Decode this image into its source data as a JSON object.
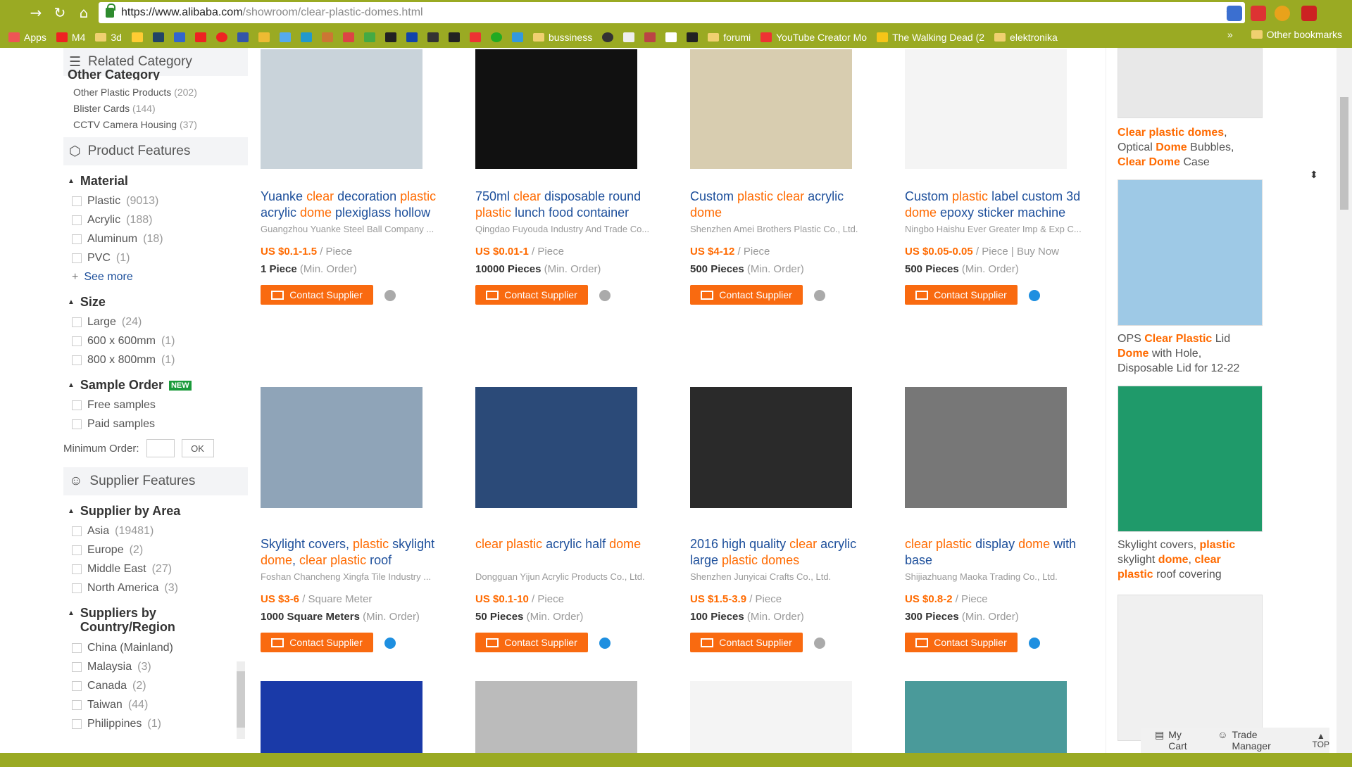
{
  "browser": {
    "url_host": "https://www.alibaba.com",
    "url_path": "/showroom/clear-plastic-domes.html",
    "bookmarks": [
      "Apps",
      "M4",
      "3d",
      "bussiness",
      "forumi",
      "YouTube Creator Mo",
      "The Walking Dead (2",
      "elektronika"
    ],
    "other_bookmarks": "Other bookmarks",
    "chevron": "»"
  },
  "sidebar": {
    "related_category": "Related Category",
    "other_category": "Other Category",
    "other_items": [
      {
        "label": "Other Plastic Products",
        "count": "(202)"
      },
      {
        "label": "Blister Cards",
        "count": "(144)"
      },
      {
        "label": "CCTV Camera Housing",
        "count": "(37)"
      }
    ],
    "product_features": "Product Features",
    "material": "Material",
    "material_items": [
      {
        "label": "Plastic",
        "count": "(9013)"
      },
      {
        "label": "Acrylic",
        "count": "(188)"
      },
      {
        "label": "Aluminum",
        "count": "(18)"
      },
      {
        "label": "PVC",
        "count": "(1)"
      }
    ],
    "see_more": "See more",
    "size": "Size",
    "size_items": [
      {
        "label": "Large",
        "count": "(24)"
      },
      {
        "label": "600 x 600mm",
        "count": "(1)"
      },
      {
        "label": "800 x 800mm",
        "count": "(1)"
      }
    ],
    "sample_order": "Sample Order",
    "new_badge": "NEW",
    "sample_items": [
      "Free samples",
      "Paid samples"
    ],
    "min_order_label": "Minimum Order:",
    "ok": "OK",
    "supplier_features": "Supplier Features",
    "supplier_by_area": "Supplier by Area",
    "area_items": [
      {
        "label": "Asia",
        "count": "(19481)"
      },
      {
        "label": "Europe",
        "count": "(2)"
      },
      {
        "label": "Middle East",
        "count": "(27)"
      },
      {
        "label": "North America",
        "count": "(3)"
      }
    ],
    "suppliers_by_country": "Suppliers by Country/Region",
    "country_items": [
      {
        "label": "China (Mainland)",
        "count": ""
      },
      {
        "label": "Malaysia",
        "count": "(3)"
      },
      {
        "label": "Canada",
        "count": "(2)"
      },
      {
        "label": "Taiwan",
        "count": "(44)"
      },
      {
        "label": "Philippines",
        "count": "(1)"
      }
    ]
  },
  "products": [
    {
      "title_parts": [
        [
          "Yuanke ",
          0
        ],
        [
          "clear",
          1
        ],
        [
          " decoration ",
          0
        ],
        [
          "plastic",
          1
        ],
        [
          " acrylic ",
          0
        ],
        [
          "dome",
          1
        ],
        [
          " plexiglass hollow",
          0
        ]
      ],
      "supplier": "Guangzhou Yuanke Steel Ball Company ...",
      "price": "US $0.1-1.5",
      "unit": " / Piece",
      "moq": "1 Piece",
      "chat": "#aaa",
      "img": "#c9d3da"
    },
    {
      "title_parts": [
        [
          "750ml ",
          0
        ],
        [
          "clear",
          1
        ],
        [
          " disposable round ",
          0
        ],
        [
          "plastic",
          1
        ],
        [
          " lunch food container",
          0
        ]
      ],
      "supplier": "Qingdao Fuyouda Industry And Trade Co...",
      "price": "US $0.01-1",
      "unit": " / Piece",
      "moq": "10000 Pieces",
      "chat": "#aaa",
      "img": "#111"
    },
    {
      "title_parts": [
        [
          "Custom ",
          0
        ],
        [
          "plastic",
          1
        ],
        [
          " ",
          0
        ],
        [
          "clear",
          1
        ],
        [
          " acrylic ",
          0
        ],
        [
          "dome",
          1
        ]
      ],
      "supplier": "Shenzhen Amei Brothers Plastic Co., Ltd.",
      "price": "US $4-12",
      "unit": " / Piece",
      "moq": "500 Pieces",
      "chat": "#aaa",
      "img": "#d8cdb0"
    },
    {
      "title_parts": [
        [
          "Custom ",
          0
        ],
        [
          "plastic",
          1
        ],
        [
          " label custom 3d ",
          0
        ],
        [
          "dome",
          1
        ],
        [
          " epoxy sticker machine",
          0
        ]
      ],
      "supplier": "Ningbo Haishu Ever Greater Imp & Exp C...",
      "price": "US $0.05-0.05",
      "unit": " / Piece | Buy Now",
      "moq": "500 Pieces",
      "chat": "#1e8fe0",
      "img": "#f4f4f4"
    },
    {
      "title_parts": [
        [
          "Skylight covers, ",
          0
        ],
        [
          "plastic",
          1
        ],
        [
          " skylight ",
          0
        ],
        [
          "dome",
          1
        ],
        [
          ", ",
          0
        ],
        [
          "clear",
          1
        ],
        [
          " ",
          0
        ],
        [
          "plastic",
          1
        ],
        [
          " roof",
          0
        ]
      ],
      "supplier": "Foshan Chancheng Xingfa Tile Industry ...",
      "price": "US $3-6",
      "unit": " / Square Meter",
      "moq": "1000 Square Meters",
      "chat": "#1e8fe0",
      "img": "#8fa4b8"
    },
    {
      "title_parts": [
        [
          "clear",
          1
        ],
        [
          " ",
          0
        ],
        [
          "plastic",
          1
        ],
        [
          " acrylic half ",
          0
        ],
        [
          "dome",
          1
        ]
      ],
      "supplier": "Dongguan Yijun Acrylic Products Co., Ltd.",
      "price": "US $0.1-10",
      "unit": " / Piece",
      "moq": "50 Pieces",
      "chat": "#1e8fe0",
      "img": "#2b4a78"
    },
    {
      "title_parts": [
        [
          "2016 high quality ",
          0
        ],
        [
          "clear",
          1
        ],
        [
          " acrylic large ",
          0
        ],
        [
          "plastic",
          1
        ],
        [
          " ",
          0
        ],
        [
          "domes",
          1
        ]
      ],
      "supplier": "Shenzhen Junyicai Crafts Co., Ltd.",
      "price": "US $1.5-3.9",
      "unit": " / Piece",
      "moq": "100 Pieces",
      "chat": "#aaa",
      "img": "#2a2a2a"
    },
    {
      "title_parts": [
        [
          "clear",
          1
        ],
        [
          " ",
          0
        ],
        [
          "plastic",
          1
        ],
        [
          " display ",
          0
        ],
        [
          "dome",
          1
        ],
        [
          " with base",
          0
        ]
      ],
      "supplier": "Shijiazhuang Maoka Trading Co., Ltd.",
      "price": "US $0.8-2",
      "unit": " / Piece",
      "moq": "300 Pieces",
      "chat": "#1e8fe0",
      "img": "#777"
    }
  ],
  "common": {
    "contact": "Contact Supplier",
    "min_order": "(Min. Order)"
  },
  "right": [
    {
      "parts": [
        [
          "Clear plastic domes",
          1
        ],
        [
          ", Optical ",
          0
        ],
        [
          "Dome",
          1
        ],
        [
          " Bubbles, ",
          0
        ],
        [
          "Clear Dome",
          1
        ],
        [
          " Case",
          0
        ]
      ],
      "img": "#ddd"
    },
    {
      "parts": [
        [
          "OPS ",
          0
        ],
        [
          "Clear Plastic",
          1
        ],
        [
          " Lid ",
          0
        ],
        [
          "Dome",
          1
        ],
        [
          " with Hole, Disposable Lid for 12-22",
          0
        ]
      ],
      "img": "#9ec9e6"
    },
    {
      "parts": [
        [
          "Skylight covers, ",
          0
        ],
        [
          "plastic",
          1
        ],
        [
          " skylight ",
          0
        ],
        [
          "dome",
          1
        ],
        [
          ", ",
          0
        ],
        [
          "clear plastic",
          1
        ],
        [
          " roof covering",
          0
        ]
      ],
      "img": "#1f9a6a"
    }
  ],
  "trade": {
    "cart": "My Cart",
    "manager": "Trade Manager",
    "top": "TOP"
  }
}
